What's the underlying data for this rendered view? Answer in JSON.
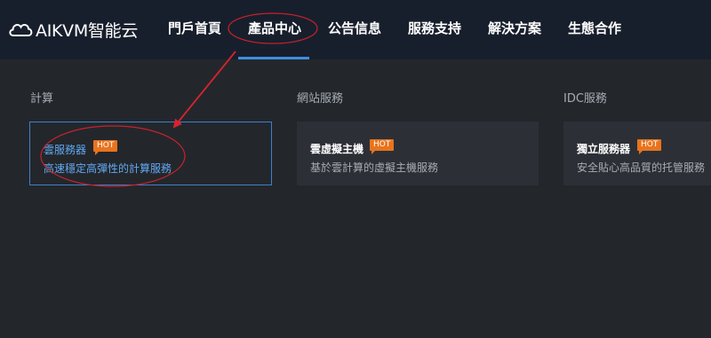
{
  "brand": {
    "name": "AIKVM智能云"
  },
  "nav": {
    "items": [
      {
        "label": "門戶首頁"
      },
      {
        "label": "產品中心"
      },
      {
        "label": "公告信息"
      },
      {
        "label": "服務支持"
      },
      {
        "label": "解決方案"
      },
      {
        "label": "生態合作"
      }
    ],
    "active_index": 1
  },
  "mega_menu": {
    "categories": [
      {
        "title": "計算",
        "product": {
          "name": "雲服務器",
          "badge": "HOT",
          "desc": "高速穩定高彈性的計算服務"
        }
      },
      {
        "title": "網站服務",
        "product": {
          "name": "雲虛擬主機",
          "badge": "HOT",
          "desc": "基於雲計算的虛擬主機服務"
        }
      },
      {
        "title": "IDC服務",
        "product": {
          "name": "獨立服務器",
          "badge": "HOT",
          "desc": "安全貼心高品質的托管服務"
        }
      }
    ]
  },
  "colors": {
    "nav_background": "#181f2c",
    "page_background": "#23272c",
    "accent": "#3f8fe0",
    "hot_badge": "#e8741e",
    "annotation": "#d9232d"
  }
}
